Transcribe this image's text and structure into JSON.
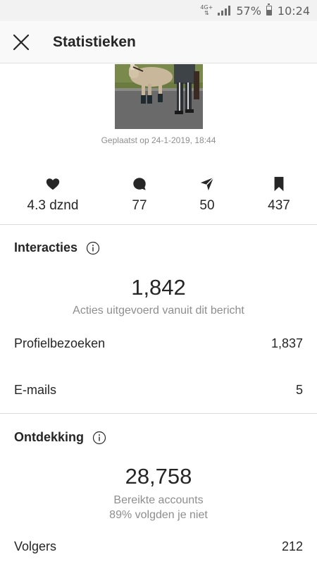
{
  "status_bar": {
    "network": "4G+",
    "battery": "57%",
    "time": "10:24"
  },
  "header": {
    "title": "Statistieken",
    "close_icon": "close-icon"
  },
  "post": {
    "posted_label": "Geplaatst op 24-1-2019, 18:44"
  },
  "metrics": [
    {
      "icon": "heart-icon",
      "value": "4.3 dznd"
    },
    {
      "icon": "comment-icon",
      "value": "77"
    },
    {
      "icon": "share-icon",
      "value": "50"
    },
    {
      "icon": "bookmark-icon",
      "value": "437"
    }
  ],
  "interactions": {
    "title": "Interacties",
    "total": "1,842",
    "subtitle": "Acties uitgevoerd vanuit dit bericht",
    "rows": [
      {
        "label": "Profielbezoeken",
        "value": "1,837"
      },
      {
        "label": "E-mails",
        "value": "5"
      }
    ]
  },
  "discovery": {
    "title": "Ontdekking",
    "total": "28,758",
    "subtitle": "Bereikte accounts",
    "subtitle2": "89% volgden je niet",
    "rows": [
      {
        "label": "Volgers",
        "value": "212"
      }
    ]
  },
  "colors": {
    "text": "#262626",
    "secondary": "#8e8e8e",
    "divider": "#dbdbdb",
    "header_bg": "#f9f9f9",
    "status_bg": "#f2f2f2"
  }
}
